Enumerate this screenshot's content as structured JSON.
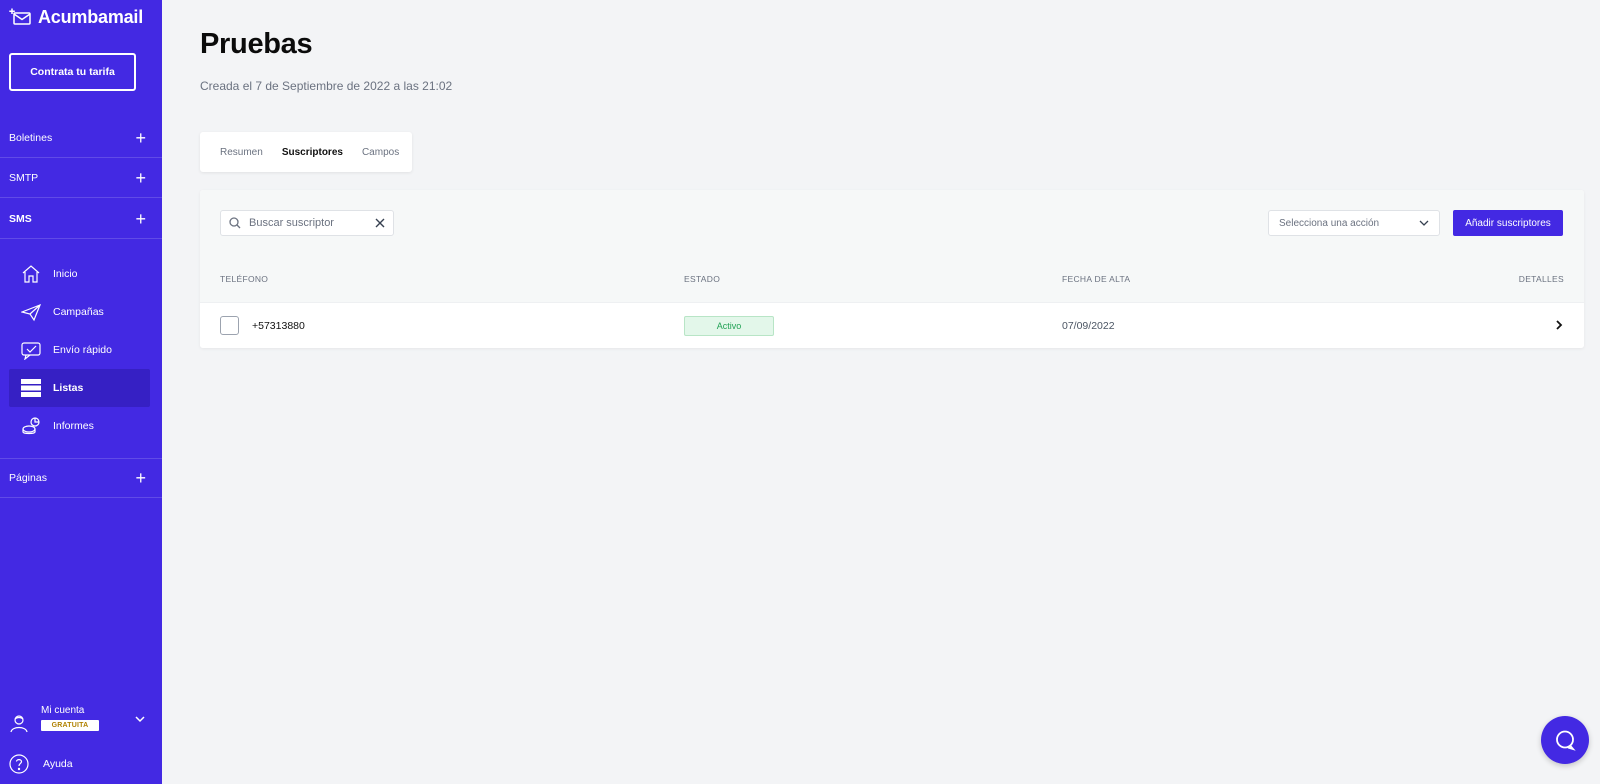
{
  "app": {
    "brand": "Acumbamail",
    "accent": "#4329e3"
  },
  "sidebar": {
    "plan_button": "Contrata tu tarifa",
    "sections": [
      {
        "label": "Boletines"
      },
      {
        "label": "SMTP"
      },
      {
        "label": "SMS"
      },
      {
        "label": "Páginas"
      }
    ],
    "nav": [
      {
        "label": "Inicio",
        "icon": "home-icon"
      },
      {
        "label": "Campañas",
        "icon": "paper-plane-icon"
      },
      {
        "label": "Envío rápido",
        "icon": "chat-check-icon"
      },
      {
        "label": "Listas",
        "icon": "list-icon",
        "active": true
      },
      {
        "label": "Informes",
        "icon": "chart-icon"
      }
    ],
    "account": {
      "label": "Mi cuenta",
      "badge": "GRATUITA"
    },
    "help": "Ayuda"
  },
  "main": {
    "title": "Pruebas",
    "subtitle": "Creada el 7 de Septiembre de 2022 a las 21:02",
    "tabs": [
      {
        "label": "Resumen"
      },
      {
        "label": "Suscriptores",
        "active": true
      },
      {
        "label": "Campos"
      }
    ],
    "search": {
      "placeholder": "Buscar suscriptor",
      "value": ""
    },
    "action_select": {
      "label": "Selecciona una acción"
    },
    "add_button": "Añadir suscriptores",
    "table": {
      "headers": [
        "TELÉFONO",
        "ESTADO",
        "FECHA DE ALTA",
        "DETALLES"
      ],
      "rows": [
        {
          "phone": "+57313880",
          "status": "Activo",
          "date": "07/09/2022"
        }
      ]
    }
  }
}
